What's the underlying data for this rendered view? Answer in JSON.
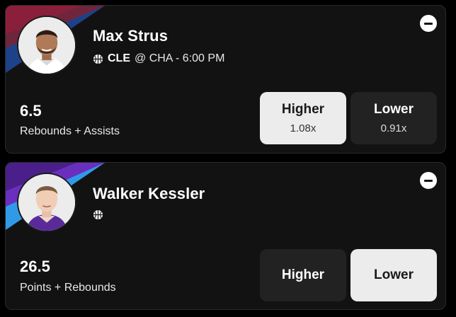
{
  "colors": {
    "card_bg": "#121212",
    "selected_bg": "#ececec",
    "idle_bg": "#222222",
    "stripe_cle_a": "#6f263d",
    "stripe_cle_b": "#1d428a",
    "stripe_uta_a": "#6b2fbf",
    "stripe_uta_b": "#2f9be8"
  },
  "cards": [
    {
      "player": "Max Strus",
      "team": "CLE",
      "matchup_rest": "@ CHA - 6:00 PM",
      "line": "6.5",
      "stat": "Rebounds + Assists",
      "higher": {
        "label": "Higher",
        "multiplier": "1.08x",
        "selected": true
      },
      "lower": {
        "label": "Lower",
        "multiplier": "0.91x",
        "selected": false
      }
    },
    {
      "player": "Walker Kessler",
      "line": "26.5",
      "stat": "Points + Rebounds",
      "higher": {
        "label": "Higher",
        "selected": false
      },
      "lower": {
        "label": "Lower",
        "selected": true
      }
    }
  ]
}
